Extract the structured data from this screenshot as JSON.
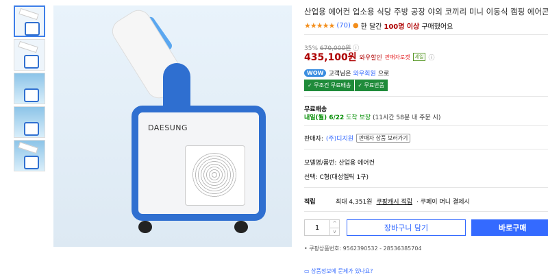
{
  "product": {
    "title": "산업용 에어컨 업소용 식당 주방 공장 야외 코끼리 미니 이동식 캠핑 에어콘",
    "brand_text": "DAESUNG",
    "rating_stars": "★★★★★",
    "review_count": "(70)",
    "purchase_text": "한 달간",
    "purchase_count": "100명 이상",
    "purchase_suffix": "구매했어요"
  },
  "pricing": {
    "discount": "35%",
    "original": "670,000원",
    "price": "435,100원",
    "wow_discount": "와우할인",
    "seller_coupon": "판매자로켓",
    "mini_badge": "세일",
    "info_icon": "ⓘ",
    "wow_badge": "WOW",
    "wow_text_pre": "고객님은",
    "wow_link": "와우회원",
    "wow_text_post": "으로",
    "ship_badges": [
      "✓ 무조건 무료배송",
      "✓ 무료반품"
    ]
  },
  "delivery": {
    "label": "무료배송",
    "date": "내일(월) 6/22",
    "arrive": "도착 보장",
    "note": "(11시간 58분 내 주문 시)"
  },
  "seller": {
    "label": "판매자:",
    "name": "(주)디지원",
    "more": "판매자 상품 보러가기"
  },
  "model": "모델명/품번: 산업용 에어컨",
  "option": "선택: C형(대성엘틱 1구)",
  "reward": {
    "label": "적립",
    "text_pre": "최대 4,351원",
    "cash": "쿠팡캐시 적립",
    "text_post": "· 쿠페이 머니 결제시"
  },
  "actions": {
    "quantity": "1",
    "qty_up": "^",
    "qty_down": "v",
    "cart": "장바구니 담기",
    "buy": "바로구매"
  },
  "product_code": "• 쿠팡상품번호: 9562390532 - 28536385704",
  "report_link": "상품정보에 문제가 있나요?",
  "colors": {
    "accent": "#346aff",
    "price": "#ae0000",
    "green": "#1f8b3a",
    "unit_blue": "#2f6fd0"
  },
  "thumbnails": [
    "front",
    "side",
    "angle",
    "detail",
    "outdoor"
  ]
}
